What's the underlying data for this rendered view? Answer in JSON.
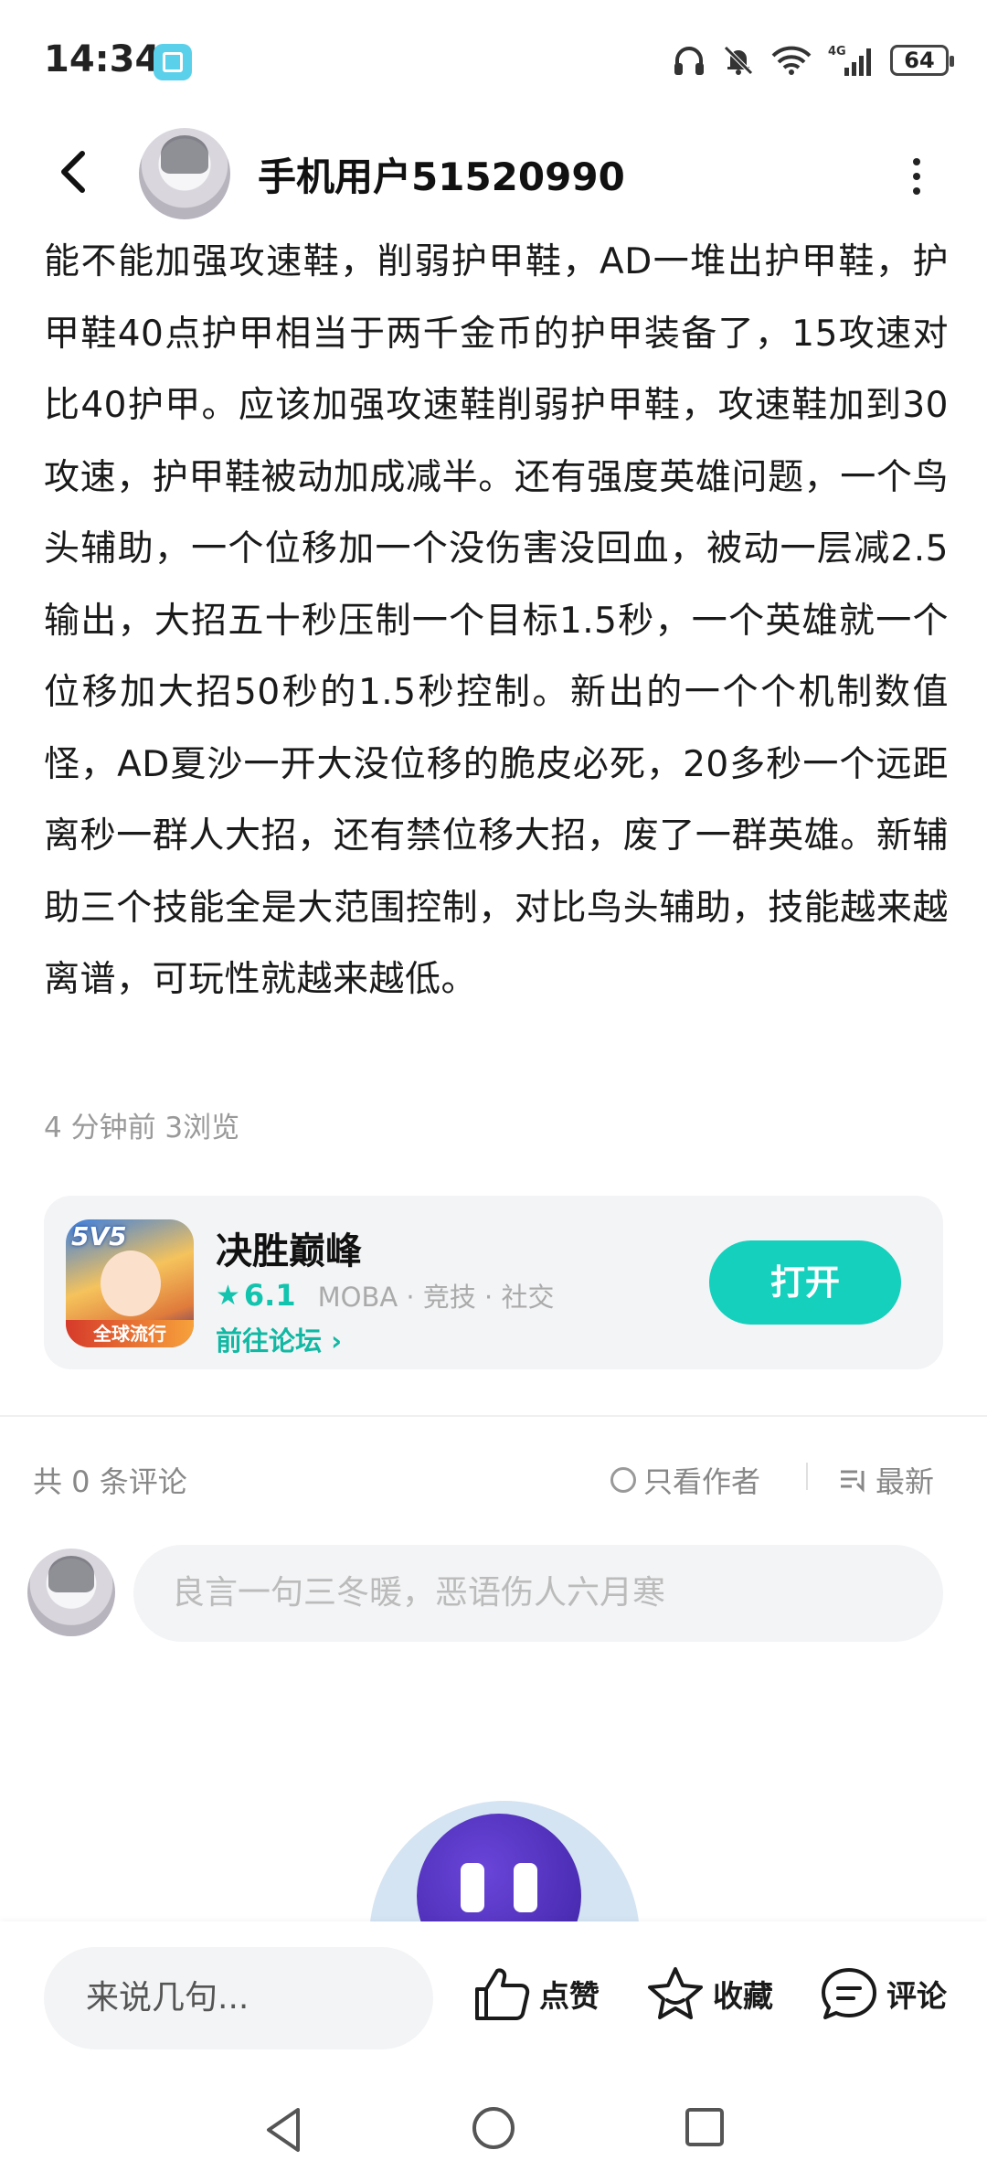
{
  "status_bar": {
    "time": "14:34",
    "battery": "64",
    "network": "4G"
  },
  "header": {
    "username": "手机用户51520990"
  },
  "post": {
    "content": "能不能加强攻速鞋，削弱护甲鞋，AD一堆出护甲鞋，护甲鞋40点护甲相当于两千金币的护甲装备了，15攻速对比40护甲。应该加强攻速鞋削弱护甲鞋，攻速鞋加到30攻速，护甲鞋被动加成减半。还有强度英雄问题，一个鸟头辅助，一个位移加一个没伤害没回血，被动一层减2.5输出，大招五十秒压制一个目标1.5秒，一个英雄就一个位移加大招50秒的1.5秒控制。新出的一个个机制数值怪，AD夏沙一开大没位移的脆皮必死，20多秒一个远距离秒一群人大招，还有禁位移大招，废了一群英雄。新辅助三个技能全是大范围控制，对比鸟头辅助，技能越来越离谱，可玩性就越来越低。",
    "meta": "4 分钟前   3浏览"
  },
  "game_card": {
    "name": "决胜巅峰",
    "rating": "6.1",
    "tags": "MOBA · 竞技 · 社交",
    "forum_link": "前往论坛",
    "open_label": "打开",
    "icon_badge": "5V5",
    "icon_banner": "全球流行"
  },
  "comments": {
    "count_text": "共 0 条评论",
    "author_only": "只看作者",
    "sort_label": "最新",
    "input_placeholder": "良言一句三冬暖，恶语伤人六月寒"
  },
  "bottom_bar": {
    "say_placeholder": "来说几句...",
    "like_label": "点赞",
    "favorite_label": "收藏",
    "comment_label": "评论"
  },
  "colors": {
    "accent": "#14d0bd",
    "accent_text": "#12b8a3",
    "muted_text": "#999999",
    "input_bg": "#f3f4f6"
  }
}
